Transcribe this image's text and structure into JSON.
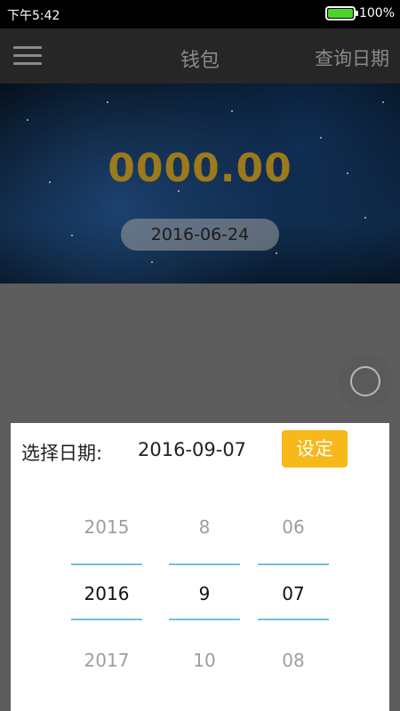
{
  "status_bar": {
    "time": "下午5:42",
    "battery": "100%"
  },
  "app_bar": {
    "title": "钱包",
    "query_date_label": "查询日期"
  },
  "banner": {
    "balance": "0000.00",
    "date": "2016-06-24"
  },
  "dialog": {
    "label": "选择日期:",
    "selected_date": "2016-09-07",
    "set_button_label": "设定",
    "columns": [
      {
        "name": "year",
        "prev": "2015",
        "selected": "2016",
        "next": "2017"
      },
      {
        "name": "month",
        "prev": "8",
        "selected": "9",
        "next": "10"
      },
      {
        "name": "day",
        "prev": "06",
        "selected": "07",
        "next": "08"
      }
    ]
  },
  "colors": {
    "accent": "#f7b81a",
    "balance": "#9b7a1c",
    "divider": "#6cc3de",
    "battery": "#4bd32c"
  }
}
